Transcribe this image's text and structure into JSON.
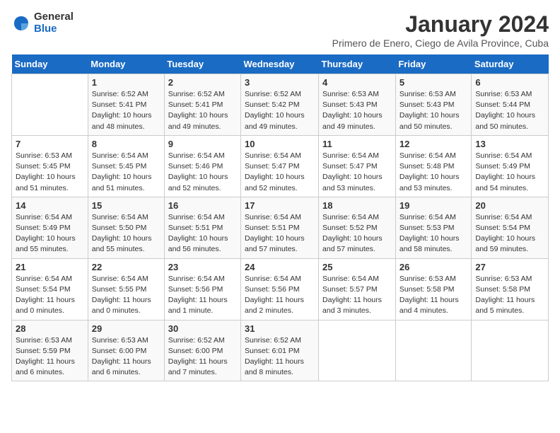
{
  "logo": {
    "general": "General",
    "blue": "Blue"
  },
  "title": "January 2024",
  "subtitle": "Primero de Enero, Ciego de Avila Province, Cuba",
  "days_header": [
    "Sunday",
    "Monday",
    "Tuesday",
    "Wednesday",
    "Thursday",
    "Friday",
    "Saturday"
  ],
  "weeks": [
    [
      {
        "day": "",
        "info": ""
      },
      {
        "day": "1",
        "info": "Sunrise: 6:52 AM\nSunset: 5:41 PM\nDaylight: 10 hours\nand 48 minutes."
      },
      {
        "day": "2",
        "info": "Sunrise: 6:52 AM\nSunset: 5:41 PM\nDaylight: 10 hours\nand 49 minutes."
      },
      {
        "day": "3",
        "info": "Sunrise: 6:52 AM\nSunset: 5:42 PM\nDaylight: 10 hours\nand 49 minutes."
      },
      {
        "day": "4",
        "info": "Sunrise: 6:53 AM\nSunset: 5:43 PM\nDaylight: 10 hours\nand 49 minutes."
      },
      {
        "day": "5",
        "info": "Sunrise: 6:53 AM\nSunset: 5:43 PM\nDaylight: 10 hours\nand 50 minutes."
      },
      {
        "day": "6",
        "info": "Sunrise: 6:53 AM\nSunset: 5:44 PM\nDaylight: 10 hours\nand 50 minutes."
      }
    ],
    [
      {
        "day": "7",
        "info": "Sunrise: 6:53 AM\nSunset: 5:45 PM\nDaylight: 10 hours\nand 51 minutes."
      },
      {
        "day": "8",
        "info": "Sunrise: 6:54 AM\nSunset: 5:45 PM\nDaylight: 10 hours\nand 51 minutes."
      },
      {
        "day": "9",
        "info": "Sunrise: 6:54 AM\nSunset: 5:46 PM\nDaylight: 10 hours\nand 52 minutes."
      },
      {
        "day": "10",
        "info": "Sunrise: 6:54 AM\nSunset: 5:47 PM\nDaylight: 10 hours\nand 52 minutes."
      },
      {
        "day": "11",
        "info": "Sunrise: 6:54 AM\nSunset: 5:47 PM\nDaylight: 10 hours\nand 53 minutes."
      },
      {
        "day": "12",
        "info": "Sunrise: 6:54 AM\nSunset: 5:48 PM\nDaylight: 10 hours\nand 53 minutes."
      },
      {
        "day": "13",
        "info": "Sunrise: 6:54 AM\nSunset: 5:49 PM\nDaylight: 10 hours\nand 54 minutes."
      }
    ],
    [
      {
        "day": "14",
        "info": "Sunrise: 6:54 AM\nSunset: 5:49 PM\nDaylight: 10 hours\nand 55 minutes."
      },
      {
        "day": "15",
        "info": "Sunrise: 6:54 AM\nSunset: 5:50 PM\nDaylight: 10 hours\nand 55 minutes."
      },
      {
        "day": "16",
        "info": "Sunrise: 6:54 AM\nSunset: 5:51 PM\nDaylight: 10 hours\nand 56 minutes."
      },
      {
        "day": "17",
        "info": "Sunrise: 6:54 AM\nSunset: 5:51 PM\nDaylight: 10 hours\nand 57 minutes."
      },
      {
        "day": "18",
        "info": "Sunrise: 6:54 AM\nSunset: 5:52 PM\nDaylight: 10 hours\nand 57 minutes."
      },
      {
        "day": "19",
        "info": "Sunrise: 6:54 AM\nSunset: 5:53 PM\nDaylight: 10 hours\nand 58 minutes."
      },
      {
        "day": "20",
        "info": "Sunrise: 6:54 AM\nSunset: 5:54 PM\nDaylight: 10 hours\nand 59 minutes."
      }
    ],
    [
      {
        "day": "21",
        "info": "Sunrise: 6:54 AM\nSunset: 5:54 PM\nDaylight: 11 hours\nand 0 minutes."
      },
      {
        "day": "22",
        "info": "Sunrise: 6:54 AM\nSunset: 5:55 PM\nDaylight: 11 hours\nand 0 minutes."
      },
      {
        "day": "23",
        "info": "Sunrise: 6:54 AM\nSunset: 5:56 PM\nDaylight: 11 hours\nand 1 minute."
      },
      {
        "day": "24",
        "info": "Sunrise: 6:54 AM\nSunset: 5:56 PM\nDaylight: 11 hours\nand 2 minutes."
      },
      {
        "day": "25",
        "info": "Sunrise: 6:54 AM\nSunset: 5:57 PM\nDaylight: 11 hours\nand 3 minutes."
      },
      {
        "day": "26",
        "info": "Sunrise: 6:53 AM\nSunset: 5:58 PM\nDaylight: 11 hours\nand 4 minutes."
      },
      {
        "day": "27",
        "info": "Sunrise: 6:53 AM\nSunset: 5:58 PM\nDaylight: 11 hours\nand 5 minutes."
      }
    ],
    [
      {
        "day": "28",
        "info": "Sunrise: 6:53 AM\nSunset: 5:59 PM\nDaylight: 11 hours\nand 6 minutes."
      },
      {
        "day": "29",
        "info": "Sunrise: 6:53 AM\nSunset: 6:00 PM\nDaylight: 11 hours\nand 6 minutes."
      },
      {
        "day": "30",
        "info": "Sunrise: 6:52 AM\nSunset: 6:00 PM\nDaylight: 11 hours\nand 7 minutes."
      },
      {
        "day": "31",
        "info": "Sunrise: 6:52 AM\nSunset: 6:01 PM\nDaylight: 11 hours\nand 8 minutes."
      },
      {
        "day": "",
        "info": ""
      },
      {
        "day": "",
        "info": ""
      },
      {
        "day": "",
        "info": ""
      }
    ]
  ]
}
